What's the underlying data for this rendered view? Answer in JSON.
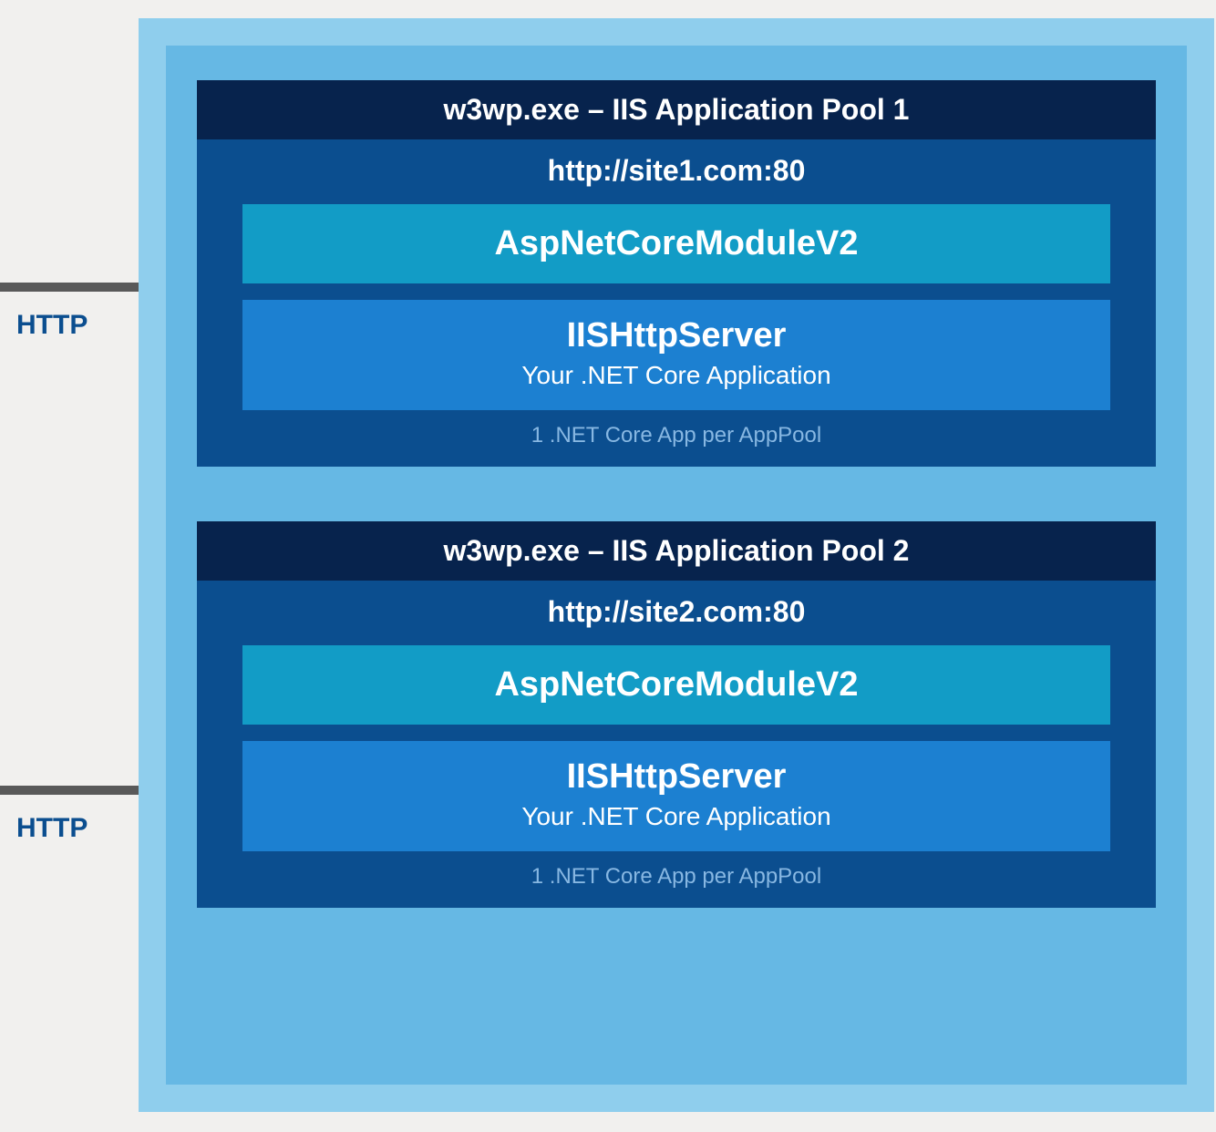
{
  "httpLabel": "HTTP",
  "pools": [
    {
      "header": "w3wp.exe – IIS Application Pool 1",
      "siteUrl": "http://site1.com:80",
      "module": "AspNetCoreModuleV2",
      "serverTitle": "IISHttpServer",
      "serverSub": "Your .NET Core Application",
      "footnote": "1 .NET Core App per AppPool"
    },
    {
      "header": "w3wp.exe – IIS Application Pool 2",
      "siteUrl": "http://site2.com:80",
      "module": "AspNetCoreModuleV2",
      "serverTitle": "IISHttpServer",
      "serverSub": "Your .NET Core Application",
      "footnote": "1 .NET Core App per AppPool"
    }
  ],
  "colors": {
    "pageBg": "#f1f0ee",
    "outerBg": "#8fceed",
    "innerBg": "#66b8e4",
    "poolBg": "#0b4e8f",
    "headerBg": "#07234d",
    "moduleBg": "#129cc6",
    "serverBg": "#1c80d1",
    "textWhite": "#ffffff",
    "footnote": "#87b7e2",
    "httpLabel": "#0b4e8f",
    "arrow": "#595959"
  }
}
